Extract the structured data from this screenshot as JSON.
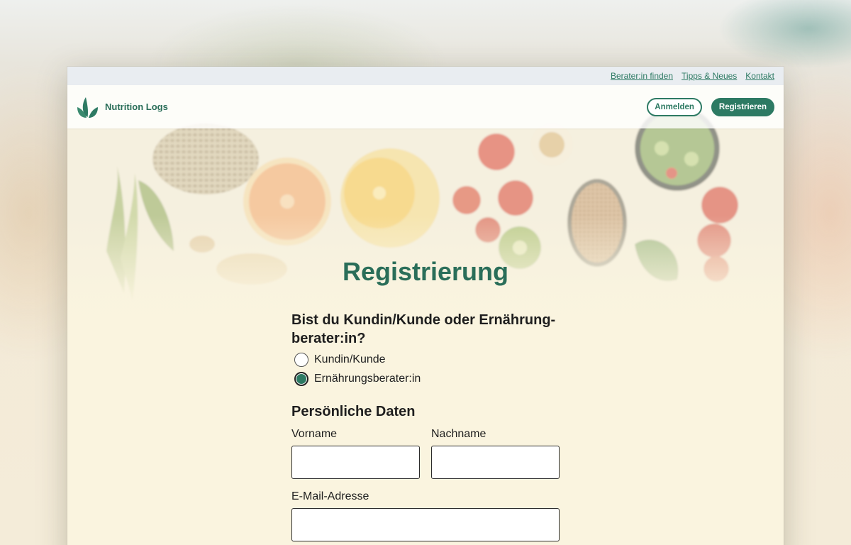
{
  "top_links": [
    "Berater:in finden",
    "Tipps & Neues",
    "Kontakt"
  ],
  "brand": {
    "name": "Nutrition Logs"
  },
  "nav": {
    "login": "Anmelden",
    "register": "Registrieren"
  },
  "page": {
    "title": "Registrierung"
  },
  "role": {
    "question": "Bist du Kundin/Kunde oder Ernährung-berater:in?",
    "options": [
      {
        "label": "Kundin/Kunde",
        "selected": false
      },
      {
        "label": "Ernährungsberater:in",
        "selected": true
      }
    ]
  },
  "personal": {
    "heading": "Persönliche Daten",
    "first_name": {
      "label": "Vorname",
      "value": ""
    },
    "last_name": {
      "label": "Nachname",
      "value": ""
    },
    "email": {
      "label": "E-Mail-Adresse",
      "value": ""
    }
  },
  "colors": {
    "accent": "#2d7a63",
    "background": "#faf4df",
    "topbar": "#e9edf1"
  }
}
